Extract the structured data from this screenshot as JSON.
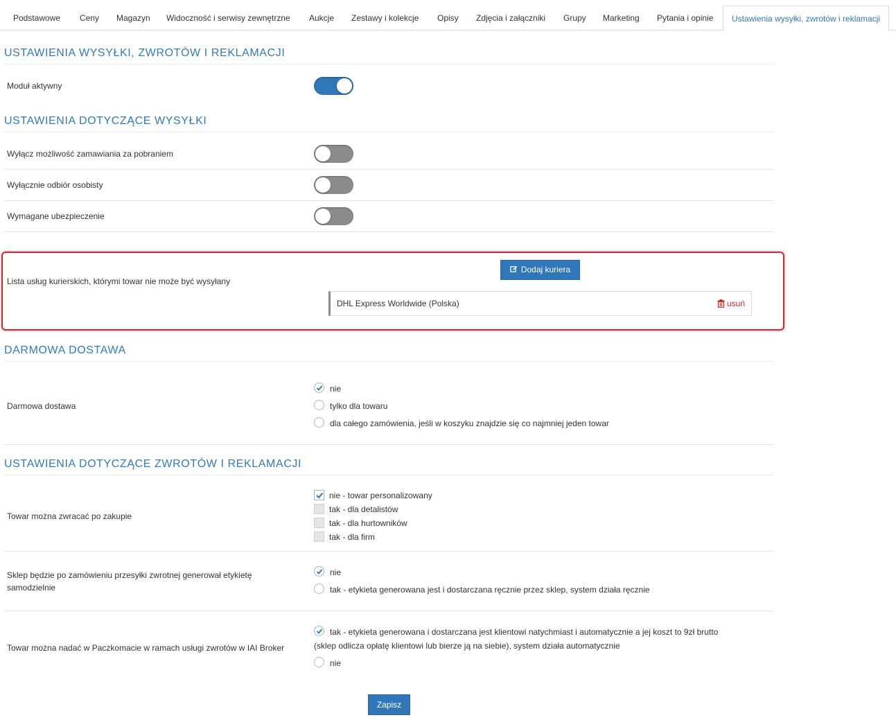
{
  "tabs": [
    {
      "label": "Podstawowe"
    },
    {
      "label": "Ceny"
    },
    {
      "label": "Magazyn"
    },
    {
      "label": "Widoczność i serwisy zewnętrzne"
    },
    {
      "label": "Aukcje"
    },
    {
      "label": "Zestawy i kolekcje"
    },
    {
      "label": "Opisy"
    },
    {
      "label": "Zdjęcia i załączniki"
    },
    {
      "label": "Grupy"
    },
    {
      "label": "Marketing"
    },
    {
      "label": "Pytania i opinie"
    },
    {
      "label": "Ustawienia wysyłki, zwrotów i reklamacji",
      "active": true
    }
  ],
  "section_main": {
    "title": "USTAWIENIA WYSYŁKI, ZWROTÓW I REKLAMACJI",
    "module_active": {
      "label": "Moduł aktywny",
      "on": true
    }
  },
  "section_shipping": {
    "title": "USTAWIENIA DOTYCZĄCE WYSYŁKI",
    "toggles": [
      {
        "label": "Wyłącz możliwość zamawiania za pobraniem",
        "on": false
      },
      {
        "label": "Wyłącznie odbiór osobisty",
        "on": false
      },
      {
        "label": "Wymagane ubezpieczenie",
        "on": false
      }
    ],
    "courier_list": {
      "label": "Lista usług kurierskich, którymi towar nie może być wysyłany",
      "add_button": "Dodaj kuriera",
      "items": [
        {
          "name": "DHL Express Worldwide (Polska)",
          "remove_label": "usuń"
        }
      ]
    }
  },
  "section_free_delivery": {
    "title": "DARMOWA DOSTAWA",
    "field_label": "Darmowa dostawa",
    "options": [
      {
        "label": "nie",
        "checked": true
      },
      {
        "label": "tylko dla towaru",
        "checked": false
      },
      {
        "label": "dla całego zamówienia, jeśli w koszyku znajdzie się co najmniej jeden towar",
        "checked": false
      }
    ]
  },
  "section_returns": {
    "title": "USTAWIENIA DOTYCZĄCE ZWROTÓW I REKLAMACJI",
    "returnable": {
      "label": "Towar można zwracać po zakupie",
      "options": [
        {
          "label": "nie - towar personalizowany",
          "checked": true
        },
        {
          "label": "tak - dla detalistów",
          "checked": false
        },
        {
          "label": "tak - dla hurtowników",
          "checked": false
        },
        {
          "label": "tak - dla firm",
          "checked": false
        }
      ]
    },
    "label_generation": {
      "label_line1": "Sklep będzie po zamówieniu przesyłki zwrotnej generował etykietę",
      "label_line2": "samodzielnie",
      "options": [
        {
          "label": "nie",
          "checked": true
        },
        {
          "label": "tak - etykieta generowana jest i dostarczana ręcznie przez sklep, system działa ręcznie",
          "checked": false
        }
      ]
    },
    "paczkomat": {
      "label": "Towar można nadać w Paczkomacie w ramach usługi zwrotów w IAI Broker",
      "options": [
        {
          "label_line1": "tak - etykieta generowana i dostarczana jest klientowi natychmiast i automatycznie a jej koszt to 9zł brutto",
          "label_line2": "(sklep odlicza opłatę klientowi lub bierze ją na siebie), system działa automatycznie",
          "checked": true
        },
        {
          "label": "nie",
          "checked": false
        }
      ]
    }
  },
  "save_button": "Zapisz",
  "colors": {
    "accent": "#2f77b8",
    "title": "#2f7bbf",
    "danger": "#c9302c",
    "highlight": "#e0202a"
  }
}
